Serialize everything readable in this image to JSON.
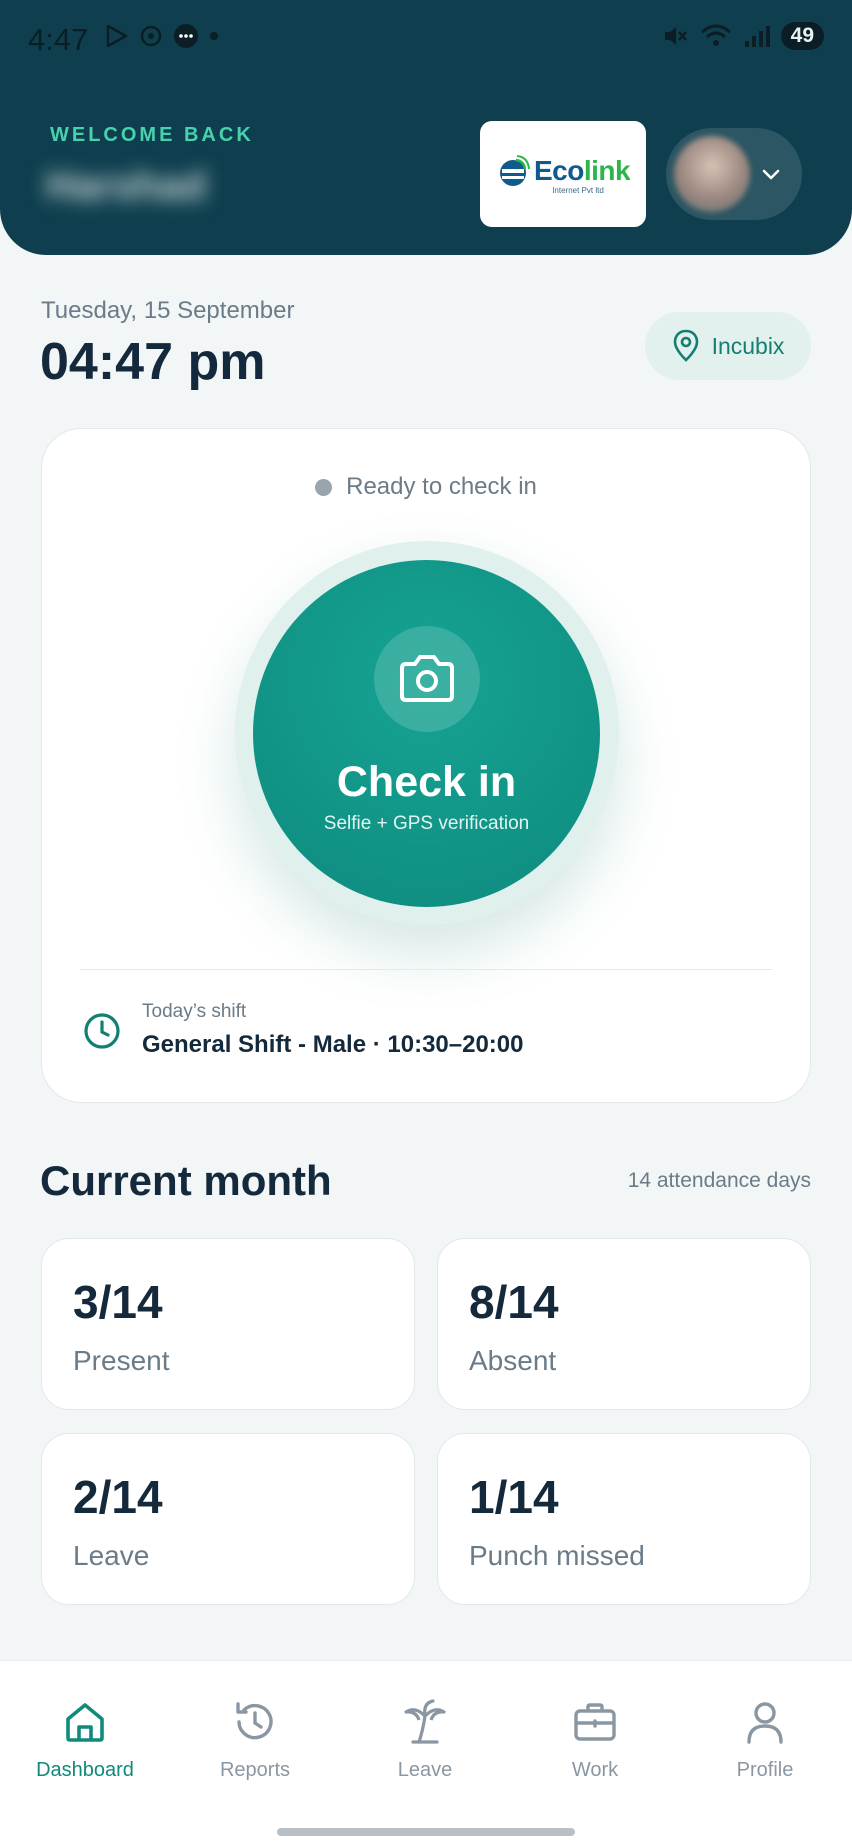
{
  "status_bar": {
    "time": "4:47",
    "battery": "49"
  },
  "header": {
    "welcome_label": "WELCOME BACK",
    "user_name": "Harshad",
    "company_name_part1": "Eco",
    "company_name_part2": "link",
    "company_tagline": "Internet Pvt ltd"
  },
  "datetime": {
    "date": "Tuesday, 15 September",
    "time": "04:47 pm"
  },
  "location": {
    "name": "Incubix"
  },
  "checkin": {
    "status": "Ready to check in",
    "button_label": "Check in",
    "button_sublabel": "Selfie + GPS verification",
    "shift_label": "Today’s shift",
    "shift_value": "General Shift - Male · 10:30–20:00"
  },
  "month": {
    "title": "Current month",
    "meta": "14 attendance days",
    "stats": [
      {
        "value": "3/14",
        "label": "Present"
      },
      {
        "value": "8/14",
        "label": "Absent"
      },
      {
        "value": "2/14",
        "label": "Leave"
      },
      {
        "value": "1/14",
        "label": "Punch missed"
      }
    ]
  },
  "nav": {
    "items": [
      {
        "label": "Dashboard",
        "icon": "home-icon"
      },
      {
        "label": "Reports",
        "icon": "history-icon"
      },
      {
        "label": "Leave",
        "icon": "palm-tree-icon"
      },
      {
        "label": "Work",
        "icon": "briefcase-icon"
      },
      {
        "label": "Profile",
        "icon": "user-icon"
      }
    ],
    "active": "Dashboard"
  },
  "colors": {
    "header_bg": "#0f3f4e",
    "accent": "#0f8a7b",
    "welcome_accent": "#48d1ad",
    "page_bg": "#f2f6f7"
  }
}
